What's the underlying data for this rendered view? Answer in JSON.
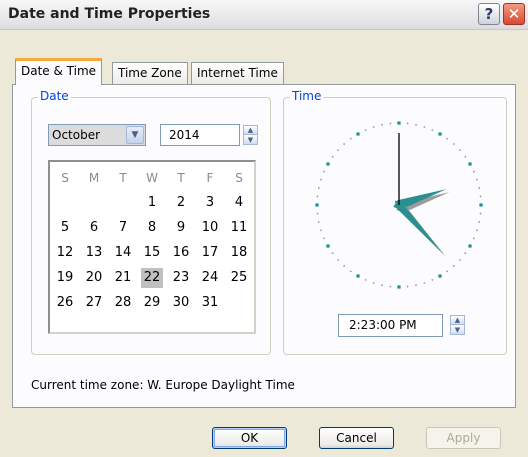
{
  "window": {
    "title": "Date and Time Properties",
    "help_label": "?",
    "close_label": "✕"
  },
  "tabs": [
    {
      "label": "Date & Time",
      "active": true
    },
    {
      "label": "Time Zone",
      "active": false
    },
    {
      "label": "Internet Time",
      "active": false
    }
  ],
  "date_group": {
    "label": "Date",
    "month": "October",
    "month_dropdown_icon": "chevron-down-icon",
    "year": "2014",
    "calendar": {
      "weekday_headers": [
        "S",
        "M",
        "T",
        "W",
        "T",
        "F",
        "S"
      ],
      "weeks": [
        [
          "",
          "",
          "",
          "1",
          "2",
          "3",
          "4"
        ],
        [
          "5",
          "6",
          "7",
          "8",
          "9",
          "10",
          "11"
        ],
        [
          "12",
          "13",
          "14",
          "15",
          "16",
          "17",
          "18"
        ],
        [
          "19",
          "20",
          "21",
          "22",
          "23",
          "24",
          "25"
        ],
        [
          "26",
          "27",
          "28",
          "29",
          "30",
          "31",
          ""
        ]
      ],
      "selected_day": "22"
    }
  },
  "time_group": {
    "label": "Time",
    "time": "2:23:00 PM",
    "clock": {
      "hour": 14,
      "minute": 23,
      "second": 0
    }
  },
  "timezone_text": "Current time zone:  W. Europe Daylight Time",
  "buttons": {
    "ok": "OK",
    "cancel": "Cancel",
    "apply": "Apply"
  },
  "colors": {
    "accent_tab": "#f7a83a",
    "group_label": "#0046d5",
    "clock_hand": "#2a8f8f"
  }
}
